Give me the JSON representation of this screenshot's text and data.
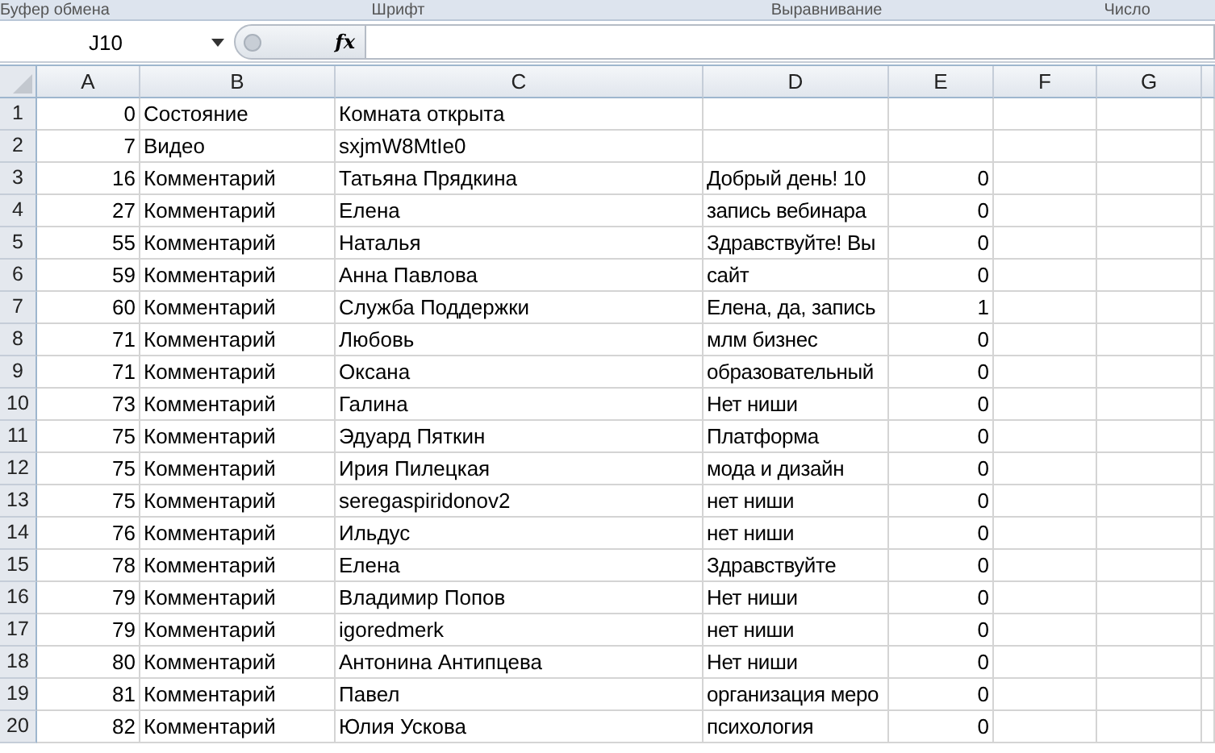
{
  "ribbon_groups": [
    "Буфер обмена",
    "Шрифт",
    "Выравнивание",
    "Число"
  ],
  "name_box": {
    "value": "J10"
  },
  "formula_bar": {
    "fx": "fx"
  },
  "columns": [
    "A",
    "B",
    "C",
    "D",
    "E",
    "F",
    "G"
  ],
  "rows": [
    {
      "number": "1",
      "a": "0",
      "b": "Состояние",
      "c": "Комната открыта"
    },
    {
      "number": "2",
      "a": "7",
      "b": "Видео",
      "c": "sxjmW8MtIe0"
    },
    {
      "number": "3",
      "a": "16",
      "b": "Комментарий",
      "c": "Татьяна Прядкина",
      "d": "Добрый день!  10",
      "e": "0"
    },
    {
      "number": "4",
      "a": "27",
      "b": "Комментарий",
      "c": "Елена",
      "d": "запись вебинара",
      "e": "0"
    },
    {
      "number": "5",
      "a": "55",
      "b": "Комментарий",
      "c": "Наталья",
      "d": "Здравствуйте! Вы",
      "e": "0"
    },
    {
      "number": "6",
      "a": "59",
      "b": "Комментарий",
      "c": "Анна Павлова",
      "d": "сайт",
      "e": "0"
    },
    {
      "number": "7",
      "a": "60",
      "b": "Комментарий",
      "c": "Служба Поддержки",
      "d": "Елена, да, запись",
      "e": "1"
    },
    {
      "number": "8",
      "a": "71",
      "b": "Комментарий",
      "c": "Любовь",
      "d": "млм бизнес",
      "e": "0"
    },
    {
      "number": "9",
      "a": "71",
      "b": "Комментарий",
      "c": "Оксана",
      "d": "образовательный",
      "e": "0"
    },
    {
      "number": "10",
      "a": "73",
      "b": "Комментарий",
      "c": "Галина",
      "d": "Нет ниши",
      "e": "0"
    },
    {
      "number": "11",
      "a": "75",
      "b": "Комментарий",
      "c": "Эдуард Пяткин",
      "d": "Платформа",
      "e": "0"
    },
    {
      "number": "12",
      "a": "75",
      "b": "Комментарий",
      "c": "Ирия  Пилецкая",
      "d": "мода и дизайн",
      "e": "0"
    },
    {
      "number": "13",
      "a": "75",
      "b": "Комментарий",
      "c": "seregaspiridonov2",
      "d": "нет ниши",
      "e": "0"
    },
    {
      "number": "14",
      "a": "76",
      "b": "Комментарий",
      "c": "Ильдус",
      "d": "нет ниши",
      "e": "0"
    },
    {
      "number": "15",
      "a": "78",
      "b": "Комментарий",
      "c": "Елена",
      "d": "Здравствуйте",
      "e": "0"
    },
    {
      "number": "16",
      "a": "79",
      "b": "Комментарий",
      "c": "Владимир Попов",
      "d": "Нет ниши",
      "e": "0"
    },
    {
      "number": "17",
      "a": "79",
      "b": "Комментарий",
      "c": "igoredmerk",
      "d": "нет ниши",
      "e": "0"
    },
    {
      "number": "18",
      "a": "80",
      "b": "Комментарий",
      "c": "Антонина Антипцева",
      "d": "Нет ниши",
      "e": "0"
    },
    {
      "number": "19",
      "a": "81",
      "b": "Комментарий",
      "c": "Павел",
      "d": "организация меро",
      "e": "0"
    },
    {
      "number": "20",
      "a": "82",
      "b": "Комментарий",
      "c": "Юлия Ускова",
      "d": "психология",
      "e": "0"
    }
  ]
}
